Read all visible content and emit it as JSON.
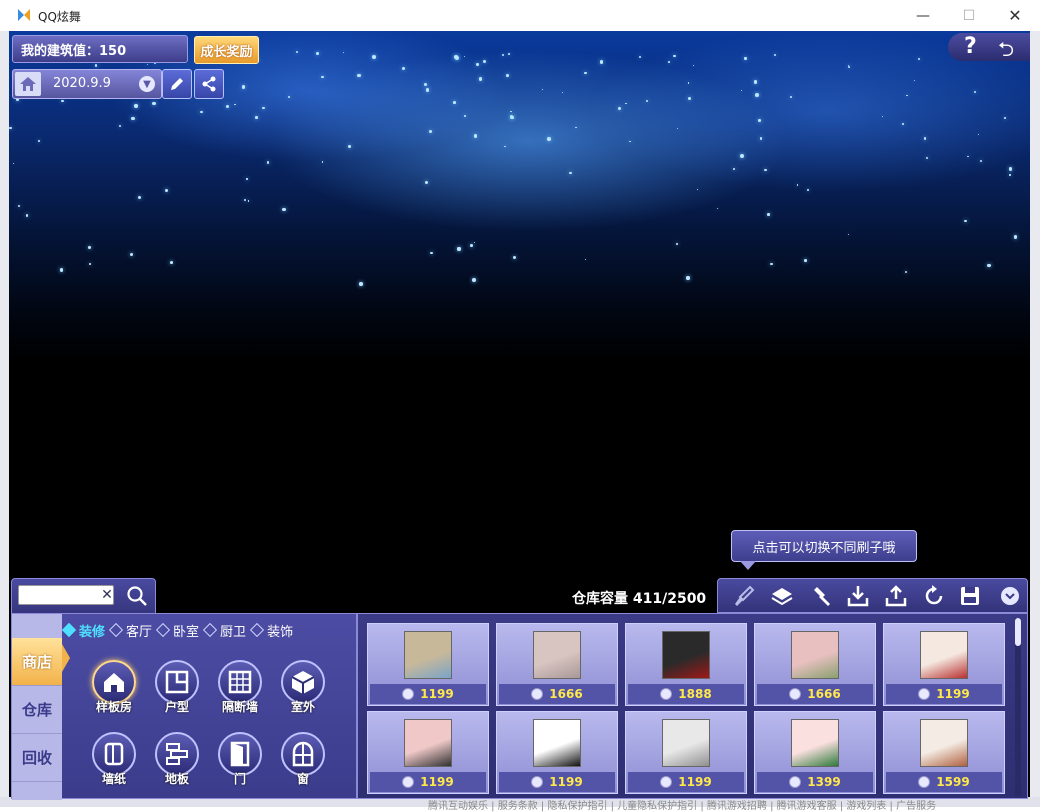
{
  "window": {
    "title": "QQ炫舞",
    "min_glyph": "—",
    "max_glyph": "☐",
    "close_glyph": "✕"
  },
  "footer_text": "腾讯互动娱乐 | 服务条款 | 隐私保护指引 | 儿童隐私保护指引 | 腾讯游戏招聘 | 腾讯游戏客服 | 游戏列表 | 广告服务",
  "build": {
    "label": "我的建筑值：150",
    "growth_reward": "成长奖励"
  },
  "date": {
    "value": "2020.9.9"
  },
  "help": {
    "question": "?",
    "back": "⮌"
  },
  "search": {
    "value": "",
    "placeholder": "",
    "clear": "✕"
  },
  "capacity": "仓库容量 411/2500",
  "tooltip": "点击可以切换不同刷子哦",
  "side_tabs": [
    "商店",
    "仓库",
    "回收"
  ],
  "categories": [
    {
      "label": "装修",
      "active": true
    },
    {
      "label": "客厅",
      "active": false
    },
    {
      "label": "卧室",
      "active": false
    },
    {
      "label": "厨卫",
      "active": false
    },
    {
      "label": "装饰",
      "active": false
    }
  ],
  "icons": [
    {
      "label": "样板房",
      "name": "sample-room",
      "active": true
    },
    {
      "label": "户型",
      "name": "floor-plan",
      "active": false
    },
    {
      "label": "隔断墙",
      "name": "partition-wall",
      "active": false
    },
    {
      "label": "室外",
      "name": "outdoor",
      "active": false
    },
    {
      "label": "墙纸",
      "name": "wallpaper",
      "active": false
    },
    {
      "label": "地板",
      "name": "floor",
      "active": false
    },
    {
      "label": "门",
      "name": "door",
      "active": false
    },
    {
      "label": "窗",
      "name": "window",
      "active": false
    }
  ],
  "items": [
    {
      "price": "1199",
      "colors": [
        "#c8b89a",
        "#7aa4c8"
      ]
    },
    {
      "price": "1666",
      "colors": [
        "#d8c4c0",
        "#a89898"
      ]
    },
    {
      "price": "1888",
      "colors": [
        "#2a2a2a",
        "#a01818"
      ]
    },
    {
      "price": "1666",
      "colors": [
        "#e8c0c0",
        "#8aa070"
      ]
    },
    {
      "price": "1199",
      "colors": [
        "#f4e8e0",
        "#b83030"
      ]
    },
    {
      "price": "1199",
      "colors": [
        "#f0c8c8",
        "#303030"
      ]
    },
    {
      "price": "1199",
      "colors": [
        "#ffffff",
        "#111111"
      ]
    },
    {
      "price": "1199",
      "colors": [
        "#e8e8e8",
        "#909090"
      ]
    },
    {
      "price": "1399",
      "colors": [
        "#fbe0e0",
        "#2e7a3a"
      ]
    },
    {
      "price": "1599",
      "colors": [
        "#f4ece4",
        "#b06040"
      ]
    }
  ]
}
